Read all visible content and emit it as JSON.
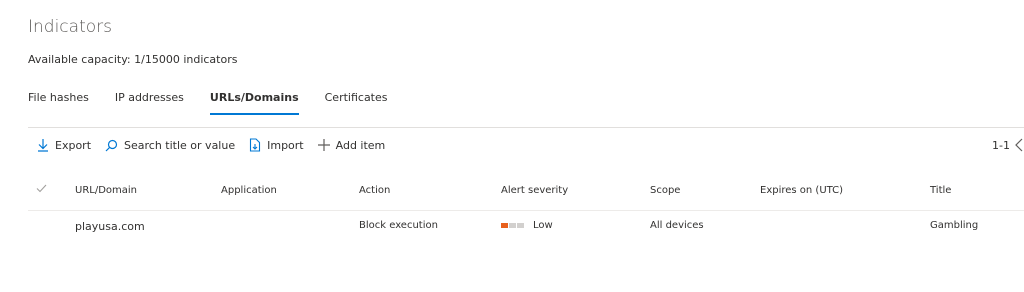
{
  "page": {
    "title": "Indicators",
    "capacity": "Available capacity:  1/15000 indicators"
  },
  "tabs": [
    {
      "label": "File hashes"
    },
    {
      "label": "IP addresses"
    },
    {
      "label": "URLs/Domains",
      "active": true
    },
    {
      "label": "Certificates"
    }
  ],
  "toolbar": {
    "export": "Export",
    "search": "Search title or value",
    "import": "Import",
    "add": "Add item"
  },
  "pager": {
    "range": "1-1"
  },
  "table": {
    "columns": [
      "URL/Domain",
      "Application",
      "Action",
      "Alert severity",
      "Scope",
      "Expires on (UTC)",
      "Title"
    ],
    "rows": [
      {
        "url": "playusa.com",
        "application": "",
        "action": "Block execution",
        "severity": "Low",
        "severity_level": 1,
        "scope": "All devices",
        "expires": "",
        "title": "Gambling"
      }
    ]
  },
  "colors": {
    "accent": "#0078d4",
    "severity_on": "#e8601c",
    "severity_off": "#d2d0ce"
  }
}
